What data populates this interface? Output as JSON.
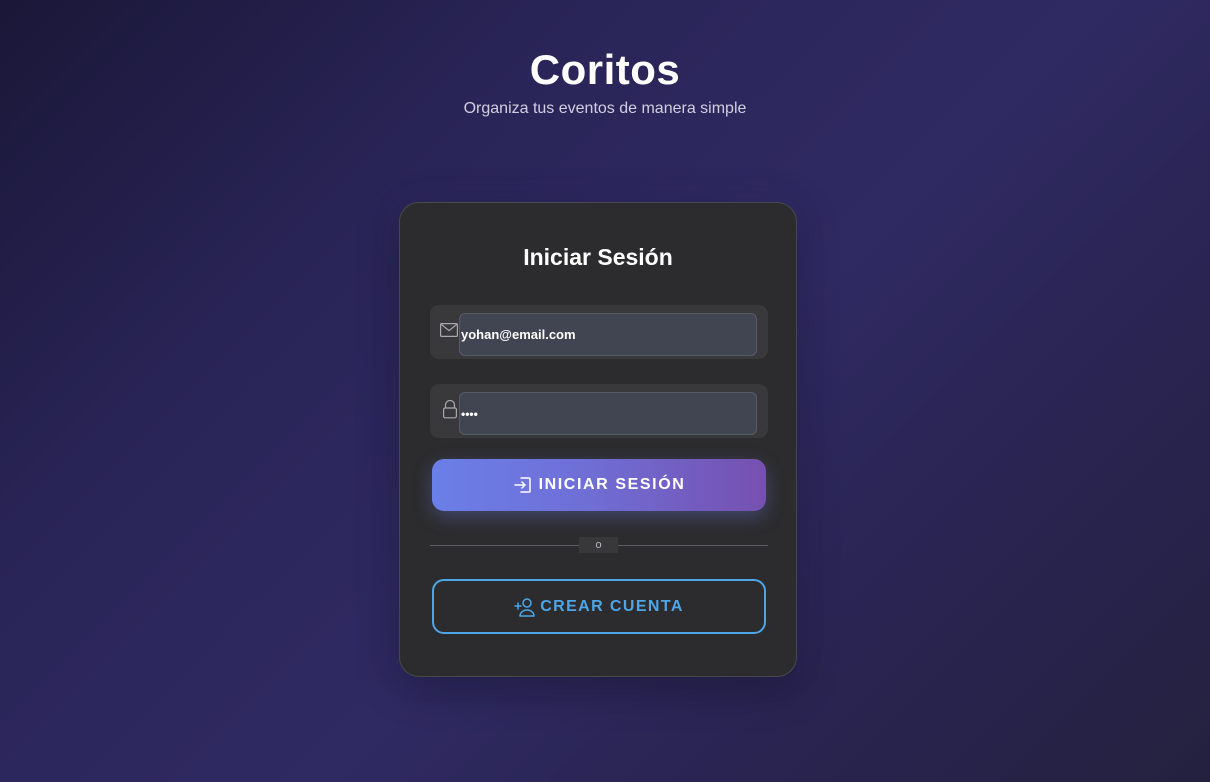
{
  "brand": {
    "title": "Coritos",
    "subtitle": "Organiza tus eventos de manera simple"
  },
  "login_card": {
    "title": "Iniciar Sesión",
    "email": {
      "icon": "mail-icon",
      "value": "yohan@email.com"
    },
    "password": {
      "icon": "lock-icon",
      "masked_value": "••••"
    },
    "login_button": {
      "icon": "login-icon",
      "label": "INICIAR SESIÓN"
    },
    "divider_label": "o",
    "create_account_button": {
      "icon": "add-user-icon",
      "label": "CREAR CUENTA"
    }
  },
  "colors": {
    "card_bg": "#2c2c2e",
    "input_bg": "#414551",
    "accent_blue": "#4da6e8",
    "gradient_start": "#6b7fe8",
    "gradient_end": "#7650b0"
  }
}
